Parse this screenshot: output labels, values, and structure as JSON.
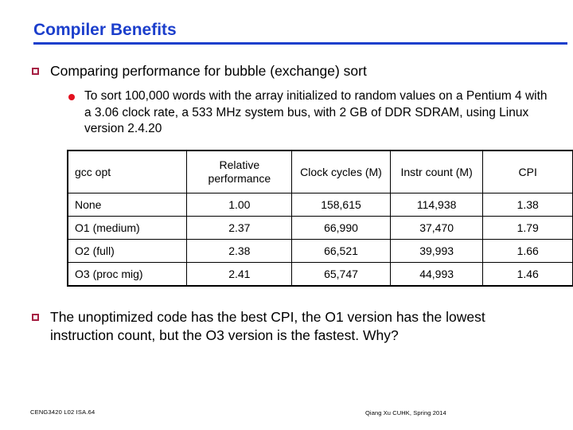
{
  "slide": {
    "title": "Compiler Benefits",
    "accent_color": "#1c3fcc",
    "bullet_square_color": "#a61f43",
    "bullet_dot_color": "#e3101f"
  },
  "bullets": {
    "compare": "Comparing performance for bubble (exchange) sort",
    "sort_detail": "To sort 100,000 words with the array initialized to random values on a Pentium 4 with a 3.06 clock rate, a 533 MHz system bus, with 2 GB of DDR SDRAM, using Linux version 2.4.20",
    "conclusion": "The unoptimized code has the best CPI, the O1 version has the lowest instruction count, but the O3 version is the fastest.  Why?"
  },
  "table": {
    "headers": [
      "gcc opt",
      "Relative performance",
      "Clock cycles (M)",
      "Instr count (M)",
      "CPI"
    ],
    "rows": [
      {
        "opt": "None",
        "relative_performance": "1.00",
        "clock_cycles_m": "158,615",
        "instr_count_m": "114,938",
        "cpi": "1.38"
      },
      {
        "opt": "O1 (medium)",
        "relative_performance": "2.37",
        "clock_cycles_m": "66,990",
        "instr_count_m": "37,470",
        "cpi": "1.79"
      },
      {
        "opt": "O2 (full)",
        "relative_performance": "2.38",
        "clock_cycles_m": "66,521",
        "instr_count_m": "39,993",
        "cpi": "1.66"
      },
      {
        "opt": "O3 (proc mig)",
        "relative_performance": "2.41",
        "clock_cycles_m": "65,747",
        "instr_count_m": "44,993",
        "cpi": "1.46"
      }
    ]
  },
  "footer": {
    "left": "CENG3420 L02 ISA.64",
    "right": "Qiang Xu  CUHK, Spring 2014"
  }
}
